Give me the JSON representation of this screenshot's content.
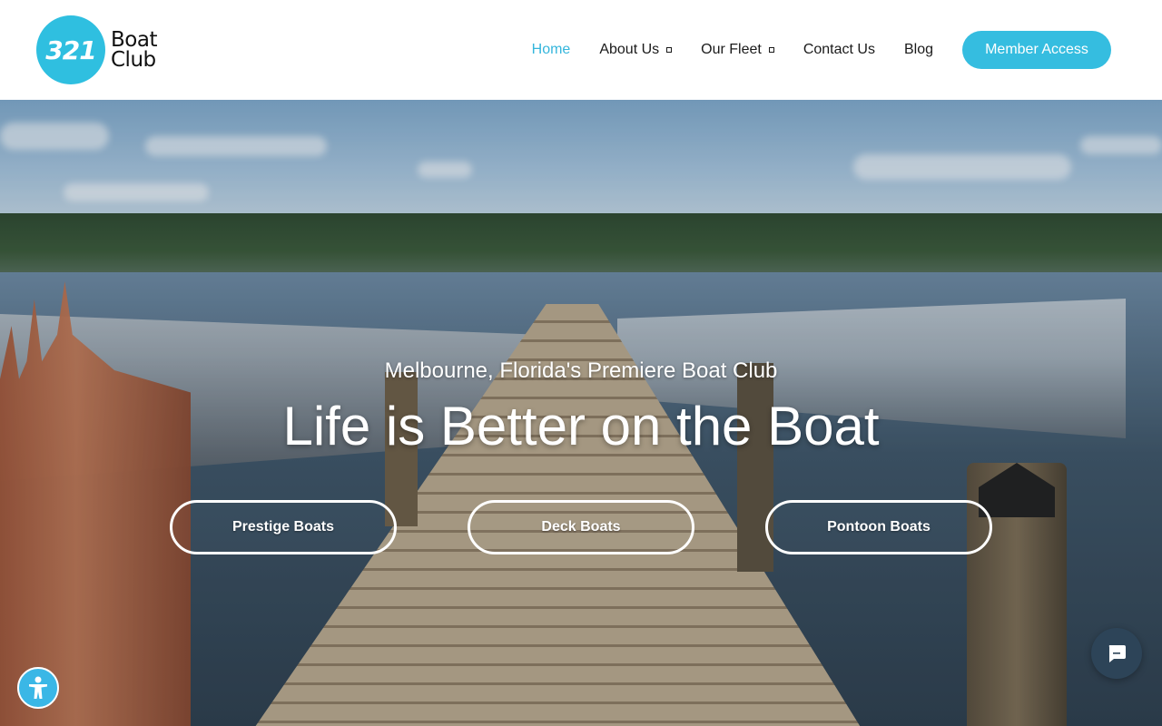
{
  "logo": {
    "number": "321",
    "word1": "Boat",
    "word2": "Club"
  },
  "nav": {
    "items": [
      {
        "label": "Home",
        "active": true,
        "dropdown": false
      },
      {
        "label": "About Us",
        "active": false,
        "dropdown": true
      },
      {
        "label": "Our Fleet",
        "active": false,
        "dropdown": true
      },
      {
        "label": "Contact Us",
        "active": false,
        "dropdown": false
      },
      {
        "label": "Blog",
        "active": false,
        "dropdown": false
      }
    ],
    "member_label": "Member Access"
  },
  "hero": {
    "subtitle": "Melbourne, Florida's Premiere Boat Club",
    "title": "Life is Better on the Boat",
    "buttons": [
      {
        "label": "Prestige Boats"
      },
      {
        "label": "Deck Boats"
      },
      {
        "label": "Pontoon Boats"
      }
    ]
  },
  "widgets": {
    "accessibility_icon": "accessibility-person-icon",
    "chat_icon": "chat-bubble-icon"
  },
  "colors": {
    "accent": "#35bde0",
    "nav_active": "#35b6dc",
    "chat_bg": "#2d4458"
  }
}
